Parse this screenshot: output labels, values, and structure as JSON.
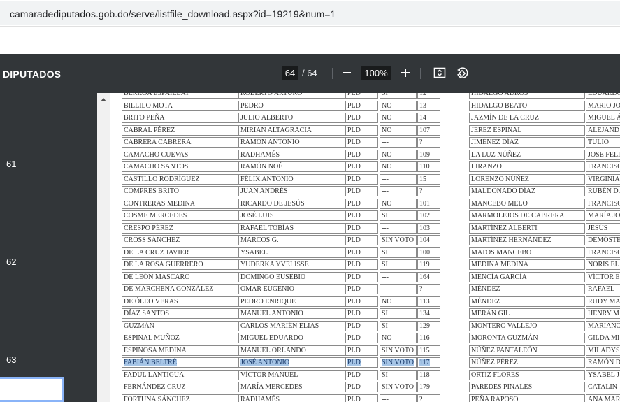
{
  "browser": {
    "url": "camaradediputados.gob.do/serve/listfile_download.aspx?id=19219&num=1"
  },
  "toolbar": {
    "title": "DIPUTADOS",
    "page_current": "64",
    "page_total": "/ 64",
    "zoom": "100%",
    "icons": [
      "zoom-out-icon",
      "zoom-in-icon",
      "fit-page-icon",
      "rotate-icon"
    ]
  },
  "sidebar": {
    "thumbnail_labels": [
      "61",
      "62",
      "63"
    ]
  },
  "left_table": {
    "rows": [
      [
        "BERROA ESPAILLAT",
        "ROBERTO ARTURO",
        "PLD",
        "SI",
        "12"
      ],
      [
        "BILLILO MOTA",
        "PEDRO",
        "PLD",
        "NO",
        "13"
      ],
      [
        "BRITO PEÑA",
        "JULIO ALBERTO",
        "PLD",
        "NO",
        "14"
      ],
      [
        "CABRAL PÉREZ",
        "MIRIAN ALTAGRACIA",
        "PLD",
        "NO",
        "107"
      ],
      [
        "CABRERA CABRERA",
        "RAMÓN ANTONIO",
        "PLD",
        "---",
        "?"
      ],
      [
        "CAMACHO CUEVAS",
        "RADHAMÉS",
        "PLD",
        "NO",
        "109"
      ],
      [
        "CAMACHO SANTOS",
        "RAMÓN NOÉ",
        "PLD",
        "NO",
        "110"
      ],
      [
        "CASTILLO RODRÍGUEZ",
        "FÉLIX ANTONIO",
        "PLD",
        "---",
        "15"
      ],
      [
        "COMPRÉS BRITO",
        "JUAN ANDRÉS",
        "PLD",
        "---",
        "?"
      ],
      [
        "CONTRERAS MEDINA",
        "RICARDO DE JESÚS",
        "PLD",
        "NO",
        "101"
      ],
      [
        "COSME MERCEDES",
        "JOSÉ LUIS",
        "PLD",
        "SI",
        "102"
      ],
      [
        "CRESPO PÉREZ",
        "RAFAEL TOBÍAS",
        "PLD",
        "---",
        "103"
      ],
      [
        "CROSS SÁNCHEZ",
        "MARCOS G.",
        "PLD",
        "SIN VOTO",
        "104"
      ],
      [
        "DE LA CRUZ JAVIER",
        "YSABEL",
        "PLD",
        "SI",
        "100"
      ],
      [
        "DE LA ROSA GUERRERO",
        "YUDERKA YVELISSE",
        "PLD",
        "SI",
        "119"
      ],
      [
        "DE LEÓN MASCARÓ",
        "DOMINGO EUSEBIO",
        "PLD",
        "---",
        "164"
      ],
      [
        "DE MARCHENA GONZÁLEZ",
        "OMAR EUGENIO",
        "PLD",
        "---",
        "?"
      ],
      [
        "DE ÓLEO VERAS",
        "PEDRO ENRIQUE",
        "PLD",
        "NO",
        "113"
      ],
      [
        "DÍAZ SANTOS",
        "MANUEL ANTONIO",
        "PLD",
        "SI",
        "134"
      ],
      [
        "GUZMÁN",
        "CARLOS MARIÉN ELIAS",
        "PLD",
        "SI",
        "129"
      ],
      [
        "ESPINAL MUÑOZ",
        "MIGUEL EDUARDO",
        "PLD",
        "NO",
        "116"
      ],
      [
        "ESPINOSA MEDINA",
        "MANUEL ORLANDO",
        "PLD",
        "SIN VOTO",
        "115"
      ],
      [
        "FABIÁN BELTRÉ",
        "JOSÉ ANTONIO",
        "PLD",
        "SIN VOTO",
        "117"
      ],
      [
        "FADUL LANTIGUA",
        "VÍCTOR MANUEL",
        "PLD",
        "SI",
        "118"
      ],
      [
        "FERNÁNDEZ CRUZ",
        "MARÍA MERCEDES",
        "PLD",
        "SIN VOTO",
        "179"
      ],
      [
        "FORTUNA SÁNCHEZ",
        "RADHAMÉS",
        "PLD",
        "---",
        "?"
      ]
    ],
    "highlighted_row_index": 22
  },
  "right_table": {
    "rows": [
      [
        "HIDALGO ADROS",
        "EDUARDO"
      ],
      [
        "HIDALGO BEATO",
        "MARIO JO"
      ],
      [
        "JAZMÍN DE LA CRUZ",
        "MIGUEL Á"
      ],
      [
        "JEREZ ESPINAL",
        "ALEJAND"
      ],
      [
        "JIMÉNEZ DÍAZ",
        "TULIO"
      ],
      [
        "LA LUZ NÚÑEZ",
        "JOSE FELI"
      ],
      [
        "LIRANZO",
        "FRANCISC"
      ],
      [
        "LORENZO NÚÑEZ",
        "VIRGINIA"
      ],
      [
        "MALDONADO DÍAZ",
        "RUBÉN D."
      ],
      [
        "MANCEBO MELO",
        "FRANCISC"
      ],
      [
        "MARMOLEJOS DE CABRERA",
        "MARÍA JO"
      ],
      [
        "MARTÍNEZ ALBERTI",
        "JESÚS"
      ],
      [
        "MARTÍNEZ HERNÁNDEZ",
        "DEMÓSTE"
      ],
      [
        "MATOS MANCEBO",
        "FRANCISC"
      ],
      [
        "MEDINA MEDINA",
        "NORIS EL"
      ],
      [
        "MENCÍA GARCÍA",
        "VÍCTOR E"
      ],
      [
        "MÉNDEZ",
        "RAFAEL"
      ],
      [
        "MÉNDEZ",
        "RUDY MA"
      ],
      [
        "MERÁN GIL",
        "HENRY M"
      ],
      [
        "MONTERO VALLEJO",
        "MARIANO"
      ],
      [
        "MORONTA GUZMÁN",
        "GILDA MI"
      ],
      [
        "NÚÑEZ PANTALEÓN",
        "MILADYS"
      ],
      [
        "NÚÑEZ PÉREZ",
        "RAMÓN D"
      ],
      [
        "ORTIZ FLORES",
        "YSABEL J"
      ],
      [
        "PAREDES PINALES",
        "CATALIN"
      ],
      [
        "PEÑA RAPOSO",
        "ANA MAR"
      ]
    ]
  }
}
